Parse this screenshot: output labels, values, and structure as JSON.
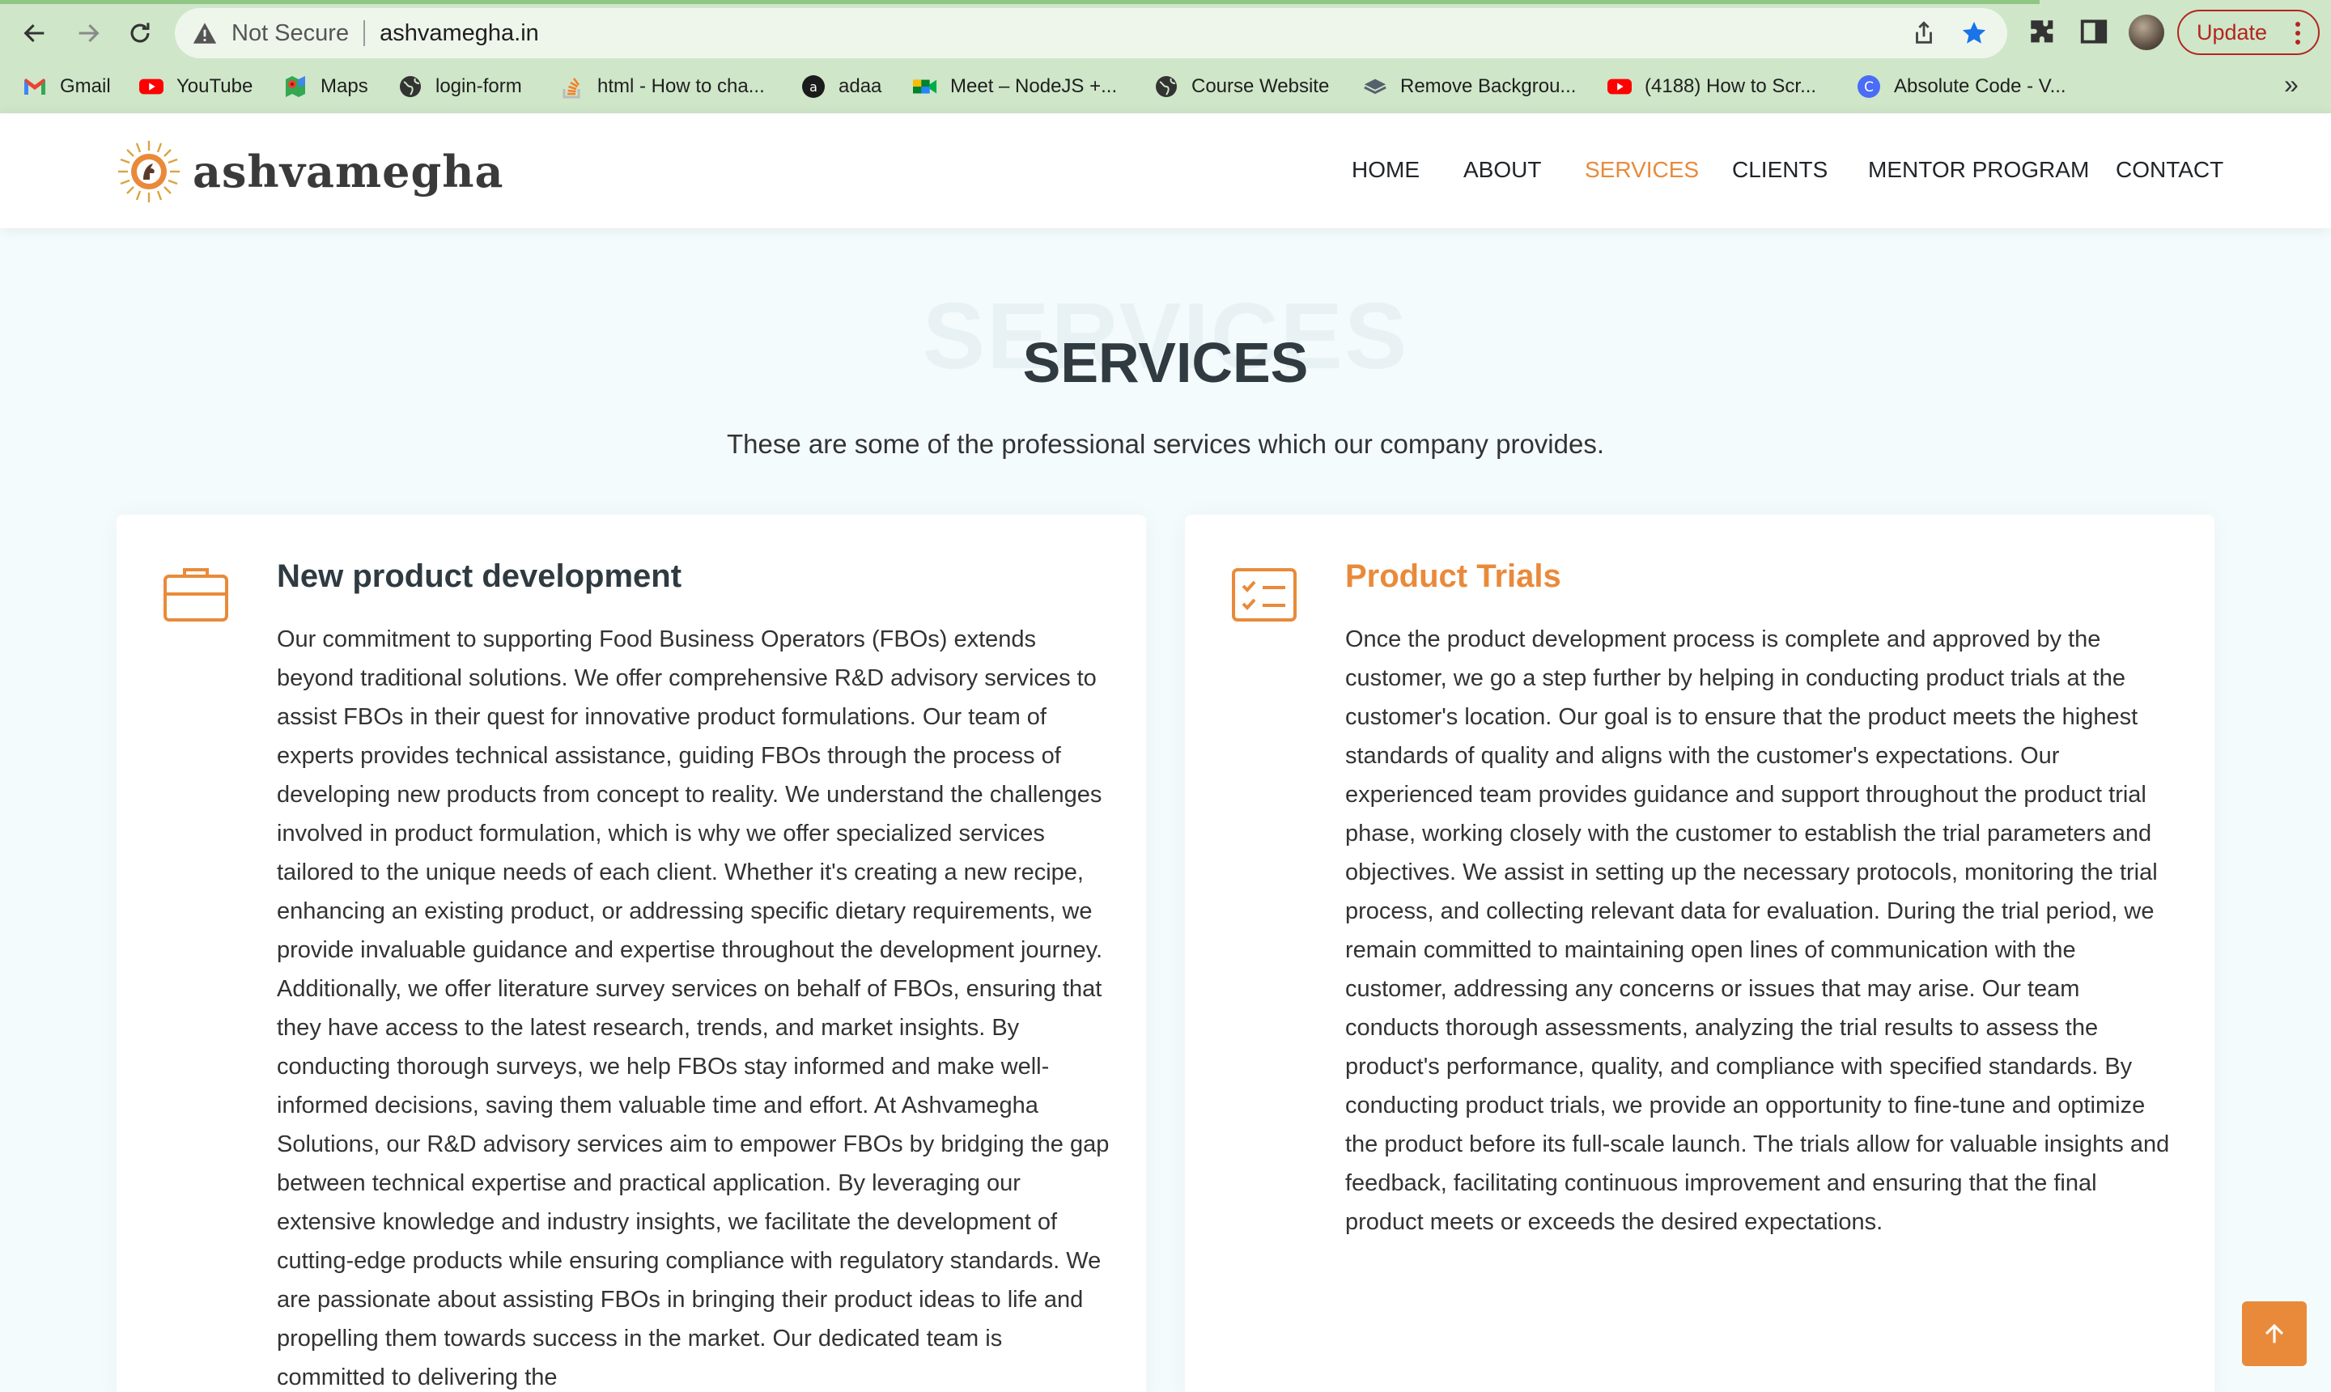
{
  "browser": {
    "omnibox": {
      "security_label": "Not Secure",
      "url": "ashvamegha.in"
    },
    "update_label": "Update",
    "bookmarks": [
      {
        "label": "Gmail",
        "icon": "gmail-icon"
      },
      {
        "label": "YouTube",
        "icon": "youtube-icon"
      },
      {
        "label": "Maps",
        "icon": "maps-icon"
      },
      {
        "label": "login-form",
        "icon": "globe-icon"
      },
      {
        "label": "html - How to cha...",
        "icon": "stackoverflow-icon"
      },
      {
        "label": "adaa",
        "icon": "adaa-icon"
      },
      {
        "label": "Meet – NodeJS +...",
        "icon": "meet-icon"
      },
      {
        "label": "Course Website",
        "icon": "globe-icon"
      },
      {
        "label": "Remove Backgrou...",
        "icon": "removebg-icon"
      },
      {
        "label": "(4188) How to Scr...",
        "icon": "youtube-icon"
      },
      {
        "label": "Absolute Code - V...",
        "icon": "absolute-code-icon"
      }
    ],
    "more_bookmarks": "»"
  },
  "site": {
    "logo_text": "ashvamegha",
    "nav": [
      {
        "label": "HOME",
        "active": false
      },
      {
        "label": "ABOUT",
        "active": false
      },
      {
        "label": "SERVICES",
        "active": true
      },
      {
        "label": "CLIENTS",
        "active": false
      },
      {
        "label": "MENTOR PROGRAM",
        "active": false
      },
      {
        "label": "CONTACT",
        "active": false
      }
    ],
    "accent_color": "#e98a3a"
  },
  "section": {
    "ghost_title": "SERVICES",
    "title": "SERVICES",
    "subtitle": "These are some of the professional services which our company provides."
  },
  "services": [
    {
      "icon": "briefcase-icon",
      "title": "New product development",
      "text": "Our commitment to supporting Food Business Operators (FBOs) extends beyond traditional solutions. We offer comprehensive R&D advisory services to assist FBOs in their quest for innovative product formulations. Our team of experts provides technical assistance, guiding FBOs through the process of developing new products from concept to reality. We understand the challenges involved in product formulation, which is why we offer specialized services tailored to the unique needs of each client. Whether it's creating a new recipe, enhancing an existing product, or addressing specific dietary requirements, we provide invaluable guidance and expertise throughout the development journey. Additionally, we offer literature survey services on behalf of FBOs, ensuring that they have access to the latest research, trends, and market insights. By conducting thorough surveys, we help FBOs stay informed and make well-informed decisions, saving them valuable time and effort. At Ashvamegha Solutions, our R&D advisory services aim to empower FBOs by bridging the gap between technical expertise and practical application. By leveraging our extensive knowledge and industry insights, we facilitate the development of cutting-edge products while ensuring compliance with regulatory standards. We are passionate about assisting FBOs in bringing their product ideas to life and propelling them towards success in the market. Our dedicated team is committed to delivering the"
    },
    {
      "icon": "checklist-icon",
      "title": "Product Trials",
      "text": "Once the product development process is complete and approved by the customer, we go a step further by helping in conducting product trials at the customer's location. Our goal is to ensure that the product meets the highest standards of quality and aligns with the customer's expectations. Our experienced team provides guidance and support throughout the product trial phase, working closely with the customer to establish the trial parameters and objectives. We assist in setting up the necessary protocols, monitoring the trial process, and collecting relevant data for evaluation. During the trial period, we remain committed to maintaining open lines of communication with the customer, addressing any concerns or issues that may arise. Our team conducts thorough assessments, analyzing the trial results to assess the product's performance, quality, and compliance with specified standards. By conducting product trials, we provide an opportunity to fine-tune and optimize the product before its full-scale launch. The trials allow for valuable insights and feedback, facilitating continuous improvement and ensuring that the final product meets or exceeds the desired expectations."
    }
  ]
}
